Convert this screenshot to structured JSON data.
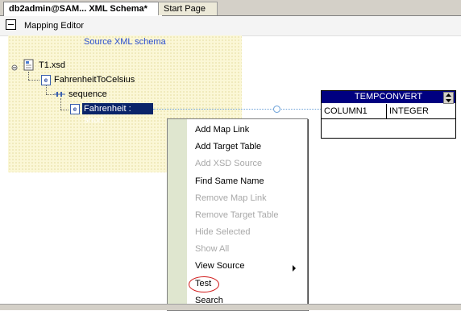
{
  "tabs": [
    {
      "label": "db2admin@SAM... XML Schema*",
      "active": true
    },
    {
      "label": "Start Page",
      "active": false
    }
  ],
  "editor": {
    "title": "Mapping Editor"
  },
  "source": {
    "label": "Source XML schema",
    "tree": {
      "file": "T1.xsd",
      "element": "FahrenheitToCelsius",
      "compositor": "sequence",
      "field": "Fahrenheit : short"
    }
  },
  "target_table": {
    "name": "TEMPCONVERT",
    "columns": [
      {
        "name": "COLUMN1",
        "type": "INTEGER"
      }
    ]
  },
  "context_menu": {
    "items": [
      {
        "label": "Add Map Link",
        "enabled": true
      },
      {
        "label": "Add Target Table",
        "enabled": true
      },
      {
        "label": "Add XSD Source",
        "enabled": false
      },
      {
        "label": "Find Same Name",
        "enabled": true
      },
      {
        "label": "Remove Map Link",
        "enabled": false
      },
      {
        "label": "Remove Target Table",
        "enabled": false
      },
      {
        "label": "Hide Selected",
        "enabled": false
      },
      {
        "label": "Show All",
        "enabled": false
      },
      {
        "label": "View Source",
        "enabled": true,
        "submenu": true
      },
      {
        "label": "Test",
        "enabled": true,
        "highlighted": true
      },
      {
        "label": "Search",
        "enabled": true
      }
    ]
  },
  "colors": {
    "selection": "#0a246a",
    "table_header": "#000080",
    "highlight_ring": "#d01818",
    "source_label": "#2b4fd1"
  }
}
